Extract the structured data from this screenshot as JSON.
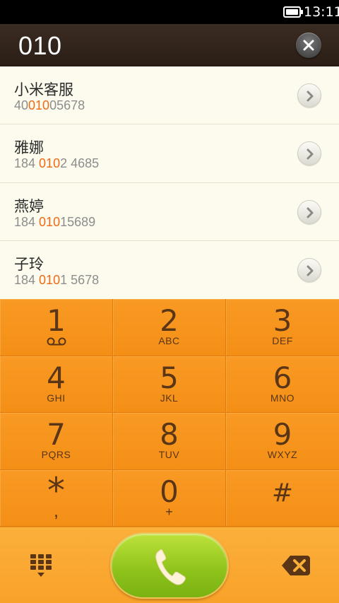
{
  "status_bar": {
    "time": "13:11",
    "battery_icon": "battery-full-icon"
  },
  "dial_header": {
    "number": "010",
    "clear_icon": "clear-x-icon"
  },
  "contacts": [
    {
      "name": "小米客服",
      "number_pre": "40",
      "number_match": "010",
      "number_post": "05678"
    },
    {
      "name": "雅娜",
      "number_pre": "184 ",
      "number_match": "010",
      "number_post": "2 4685"
    },
    {
      "name": "燕婷",
      "number_pre": "184 ",
      "number_match": "010",
      "number_post": "15689"
    },
    {
      "name": "子玲",
      "number_pre": "184 ",
      "number_match": "010",
      "number_post": "1 5678"
    }
  ],
  "keypad": [
    {
      "digit": "1",
      "letters": ""
    },
    {
      "digit": "2",
      "letters": "ABC"
    },
    {
      "digit": "3",
      "letters": "DEF"
    },
    {
      "digit": "4",
      "letters": "GHI"
    },
    {
      "digit": "5",
      "letters": "JKL"
    },
    {
      "digit": "6",
      "letters": "MNO"
    },
    {
      "digit": "7",
      "letters": "PQRS"
    },
    {
      "digit": "8",
      "letters": "TUV"
    },
    {
      "digit": "9",
      "letters": "WXYZ"
    },
    {
      "digit": "*",
      "letters": ","
    },
    {
      "digit": "0",
      "letters": "+"
    },
    {
      "digit": "#",
      "letters": ""
    }
  ],
  "bottom_bar": {
    "keypad_toggle_icon": "dialpad-grid-icon",
    "call_icon": "phone-handset-icon",
    "backspace_icon": "backspace-icon"
  },
  "colors": {
    "accent_orange": "#f7941d",
    "match_highlight": "#f06a14",
    "call_green": "#8dc21a",
    "key_text": "#5a3516"
  }
}
